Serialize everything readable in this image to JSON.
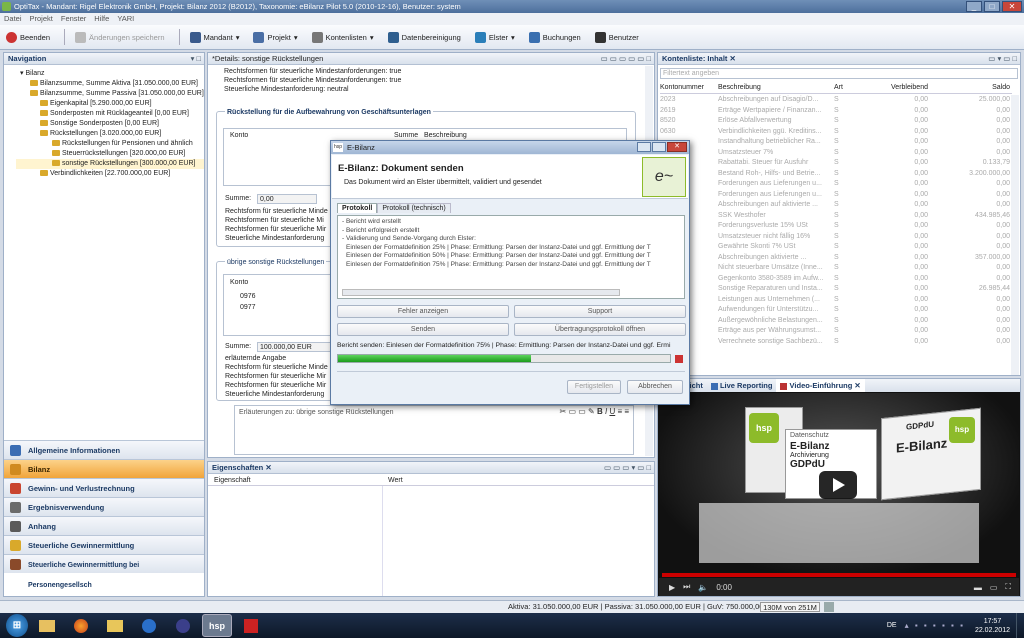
{
  "window": {
    "title": "OptiTax - Mandant: Rigel Elektronik GmbH, Projekt: Bilanz 2012 (B2012), Taxonomie: eBilanz Pilot 5.0 (2010-12-16), Benutzer: system"
  },
  "menu": [
    "Datei",
    "Projekt",
    "Fenster",
    "Hilfe",
    "YARI"
  ],
  "toolbar": {
    "beenden": "Beenden",
    "speichern": "Änderungen speichern",
    "mandant": "Mandant",
    "projekt": "Projekt",
    "kontenlisten": "Kontenlisten",
    "datenbereinigung": "Datenbereinigung",
    "elster": "Elster",
    "buchungen": "Buchungen",
    "benutzer": "Benutzer"
  },
  "navigation": {
    "title": "Navigation",
    "tree": [
      "Bilanz",
      "Bilanzsumme, Summe Aktiva [31.050.000,00 EUR]",
      "Bilanzsumme, Summe Passiva [31.050.000,00 EUR]",
      "Eigenkapital [5.290.000,00 EUR]",
      "Sonderposten mit Rücklageanteil [0,00 EUR]",
      "Sonstige Sonderposten [0,00 EUR]",
      "Rückstellungen [3.020.000,00 EUR]",
      "Rückstellungen für Pensionen und ähnlich",
      "Steuerrückstellungen [320.000,00 EUR]",
      "sonstige Rückstellungen [300.000,00 EUR]",
      "Verbindlichkeiten [22.700.000,00 EUR]"
    ],
    "sections": [
      "Allgemeine Informationen",
      "Bilanz",
      "Gewinn- und Verlustrechnung",
      "Ergebnisverwendung",
      "Anhang",
      "Steuerliche Gewinnermittlung",
      "Steuerliche Gewinnermittlung bei Personengesellsch"
    ]
  },
  "details": {
    "title": "*Details: sonstige Rückstellungen",
    "lines_top": [
      "Rechtsformen für steuerliche Mindestanforderungen: true",
      "Rechtsformen für steuerliche Mindestanforderungen: true",
      "Steuerliche Mindestanforderung: neutral"
    ],
    "group1": "Rückstellung für die Aufbewahrung von Geschäftsunterlagen",
    "col_konto": "Konto",
    "col_summe": "Summe",
    "col_beschreibung": "Beschreibung",
    "summe_label": "Summe:",
    "summe1": "0,00",
    "lines_mid": [
      "Rechtsform für steuerliche Minde",
      "Rechtsformen für steuerliche Mi",
      "Rechtsformen für steuerliche Mir",
      "Steuerliche Mindestanforderung"
    ],
    "group2": "übrige sonstige Rückstellungen",
    "konto_rows": [
      "0976",
      "0977"
    ],
    "summe2": "100.000,00 EUR",
    "lines_bottom": [
      "erläuternde Angabe",
      "Rechtsform für steuerliche Minde",
      "Rechtsformen für steuerliche Mir",
      "Rechtsformen für steuerliche Mir",
      "Steuerliche Mindestanforderung"
    ],
    "editor_title": "Erläuterungen zu: übrige sonstige Rückstellungen"
  },
  "eigenschaften": {
    "title": "Eigenschaften",
    "col1": "Eigenschaft",
    "col2": "Wert"
  },
  "kontenliste": {
    "title": "Kontenliste: Inhalt",
    "filter_placeholder": "Filtertext angeben",
    "cols": [
      "Kontonummer",
      "Beschreibung",
      "Art",
      "Verbleibend",
      "Saldo"
    ],
    "rows": [
      [
        "2023",
        "Abschreibungen auf Disagio/D...",
        "S",
        "0,00",
        "25.000,00"
      ],
      [
        "2619",
        "Erträge Wertpapiere / Finanzan...",
        "S",
        "0,00",
        "0,00"
      ],
      [
        "8520",
        "Erlöse Abfallverwertung",
        "S",
        "0,00",
        "0,00"
      ],
      [
        "0630",
        "Verbindlichkeiten ggü. Kreditins...",
        "S",
        "0,00",
        "0,00"
      ],
      [
        "",
        "Instandhaltung betrieblicher Ra...",
        "S",
        "0,00",
        "0,00"
      ],
      [
        "",
        "Umsatzsteuer 7%",
        "S",
        "0,00",
        "0,00"
      ],
      [
        "",
        "Rabattabi. Steuer für Ausfuhr",
        "S",
        "0,00",
        "0.133,79"
      ],
      [
        "",
        "Bestand Roh-, Hilfs- und Betrie...",
        "S",
        "0,00",
        "3.200.000,00"
      ],
      [
        "",
        "Forderungen aus Lieferungen u...",
        "S",
        "0,00",
        "0,00"
      ],
      [
        "",
        "Forderungen aus Lieferungen u...",
        "S",
        "0,00",
        "0,00"
      ],
      [
        "",
        "Abschreibungen auf aktivierte ...",
        "S",
        "0,00",
        "0,00"
      ],
      [
        "",
        "SSK Westhofer",
        "S",
        "0,00",
        "434.985,46"
      ],
      [
        "",
        "Forderungsverluste 15% USt",
        "S",
        "0,00",
        "0,00"
      ],
      [
        "",
        "Umsatzsteuer nicht fällig 16%",
        "S",
        "0,00",
        "0,00"
      ],
      [
        "",
        "Gewährte Skonti 7% USt",
        "S",
        "0,00",
        "0,00"
      ],
      [
        "",
        "Abschreibungen aktivierte ...",
        "S",
        "0,00",
        "357.000,00"
      ],
      [
        "",
        "Nicht steuerbare Umsätze (Inne...",
        "S",
        "0,00",
        "0,00"
      ],
      [
        "",
        "Gegenkonto 3580-3589 im Aufw...",
        "S",
        "0,00",
        "0,00"
      ],
      [
        "",
        "Sonstige Reparaturen und Insta...",
        "S",
        "0,00",
        "26.985,44"
      ],
      [
        "",
        "Leistungen aus Unternehmen (...",
        "S",
        "0,00",
        "0,00"
      ],
      [
        "",
        "Aufwendungen für Unterstützu...",
        "S",
        "0,00",
        "0,00"
      ],
      [
        "",
        "Außergewöhnliche Belastungen...",
        "S",
        "0,00",
        "0,00"
      ],
      [
        "",
        "Erträge aus per Währungsumst...",
        "S",
        "0,00",
        "0,00"
      ],
      [
        "",
        "Verrechnete sonstige Sachbezü...",
        "S",
        "0,00",
        "0,00"
      ]
    ]
  },
  "video": {
    "tabs": [
      "...nzansicht",
      "Live Reporting",
      "Video-Einführung"
    ],
    "time": "0:00",
    "sign1": "E-Bilanz",
    "sign2": "GDPdU",
    "sign3": "Datenschutz",
    "sign4": "Archivierung",
    "brand": "hsp"
  },
  "dialog": {
    "window_title": "E-Bilanz",
    "heading": "E-Bilanz: Dokument senden",
    "subheading": "Das Dokument wird an Elster übermittelt, validiert und gesendet",
    "tabs": [
      "Protokoll",
      "Protokoll (technisch)"
    ],
    "log": [
      "- Bericht wird erstellt",
      "- Bericht erfolgreich erstellt",
      "- Validierung und Sende-Vorgang durch Elster:",
      "  Einlesen der Formatdefinition 25% | Phase: Ermittlung: Parsen der Instanz-Datei und ggf. Ermittlung der T",
      "  Einlesen der Formatdefinition 50% | Phase: Ermittlung: Parsen der Instanz-Datei und ggf. Ermittlung der T",
      "  Einlesen der Formatdefinition 75% | Phase: Ermittlung: Parsen der Instanz-Datei und ggf. Ermittlung der T"
    ],
    "btn_fehler": "Fehler anzeigen",
    "btn_support": "Support",
    "btn_senden": "Senden",
    "btn_protokoll": "Übertragungsprotokoll öffnen",
    "status": "Bericht senden: Einlesen der Formatdefinition 75% | Phase: Ermittlung: Parsen der Instanz-Datei und ggf. Ermi",
    "progress": 0.58,
    "btn_fertig": "Fertigstellen",
    "btn_abbrechen": "Abbrechen"
  },
  "status": {
    "summary": "Aktiva: 31.050.000,00 EUR | Passiva: 31.050.000,00 EUR | GuV: 750.000,00 EUR",
    "memory": "130M von 251M"
  },
  "taskbar": {
    "lang": "DE",
    "time": "17:57",
    "date": "22.02.2012",
    "hsp": "hsp"
  }
}
